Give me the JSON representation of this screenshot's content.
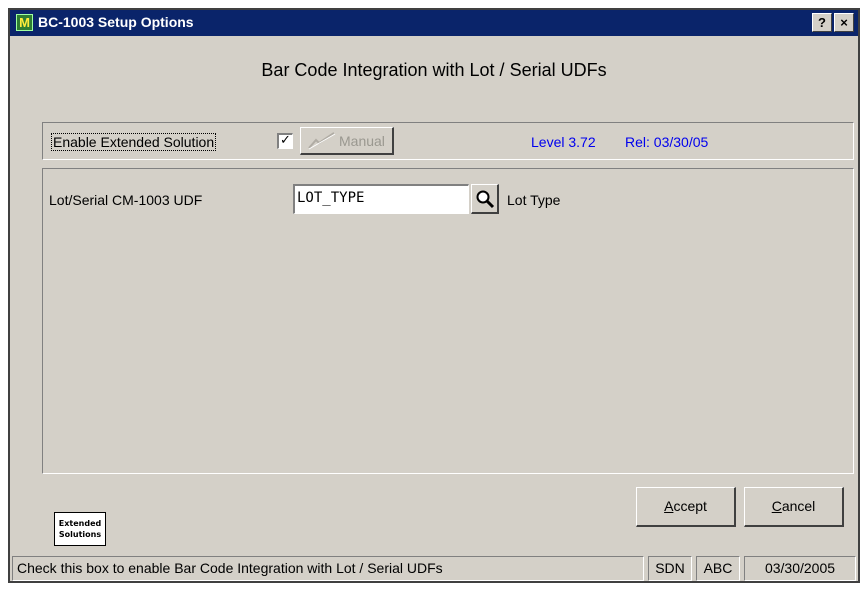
{
  "window": {
    "title": "BC-1003 Setup Options",
    "icon_letter": "M",
    "help_button": "?",
    "close_button": "×"
  },
  "heading": "Bar Code Integration with Lot / Serial UDFs",
  "enable": {
    "label": "Enable Extended Solution",
    "checked": true,
    "check_glyph": "✓",
    "manual_button": "Manual",
    "level": "Level 3.72",
    "release": "Rel: 03/30/05"
  },
  "udf": {
    "label": "Lot/Serial CM-1003 UDF",
    "value": "LOT_TYPE",
    "lookup_icon": "magnifier-icon",
    "description": "Lot Type"
  },
  "logo": {
    "line1": "Extended",
    "line2": "Solutions"
  },
  "buttons": {
    "accept_first": "A",
    "accept_rest": "ccept",
    "cancel_first": "C",
    "cancel_rest": "ancel"
  },
  "status": {
    "message": "Check this box to enable Bar Code Integration with Lot / Serial UDFs",
    "user": "SDN",
    "company": "ABC",
    "date": "03/30/2005"
  },
  "colors": {
    "titlebar": "#0a246a",
    "face": "#d4d0c8",
    "link_text": "#0000ee"
  }
}
